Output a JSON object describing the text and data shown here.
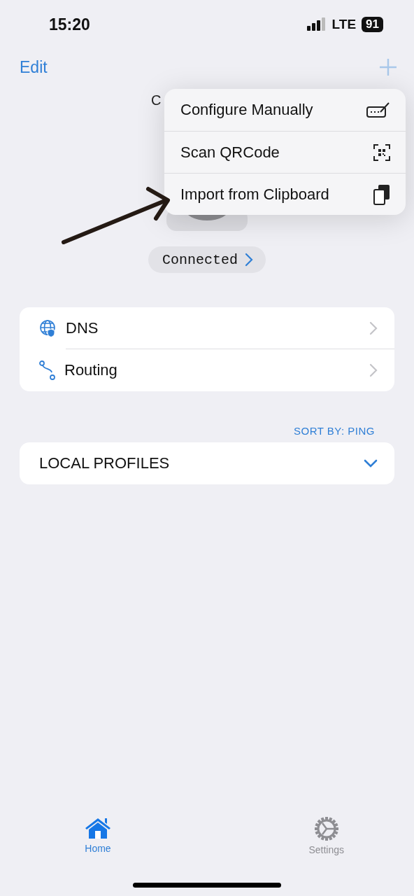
{
  "status_bar": {
    "time": "15:20",
    "network": "LTE",
    "battery": "91"
  },
  "nav": {
    "edit": "Edit"
  },
  "header": {
    "title": "C"
  },
  "menu": {
    "items": [
      {
        "label": "Configure Manually",
        "kind": "manual"
      },
      {
        "label": "Scan QRCode",
        "kind": "qr"
      },
      {
        "label": "Import from Clipboard",
        "kind": "clipboard"
      }
    ]
  },
  "status_pill": {
    "label": "Connected"
  },
  "settings_list": [
    {
      "label": "DNS",
      "kind": "dns"
    },
    {
      "label": "Routing",
      "kind": "routing"
    }
  ],
  "sort_label": "SORT BY: PING",
  "profiles": {
    "title": "LOCAL PROFILES",
    "expanded": true
  },
  "tab_bar": [
    {
      "label": "Home",
      "kind": "home",
      "selected": true
    },
    {
      "label": "Settings",
      "kind": "settings",
      "selected": false
    }
  ]
}
